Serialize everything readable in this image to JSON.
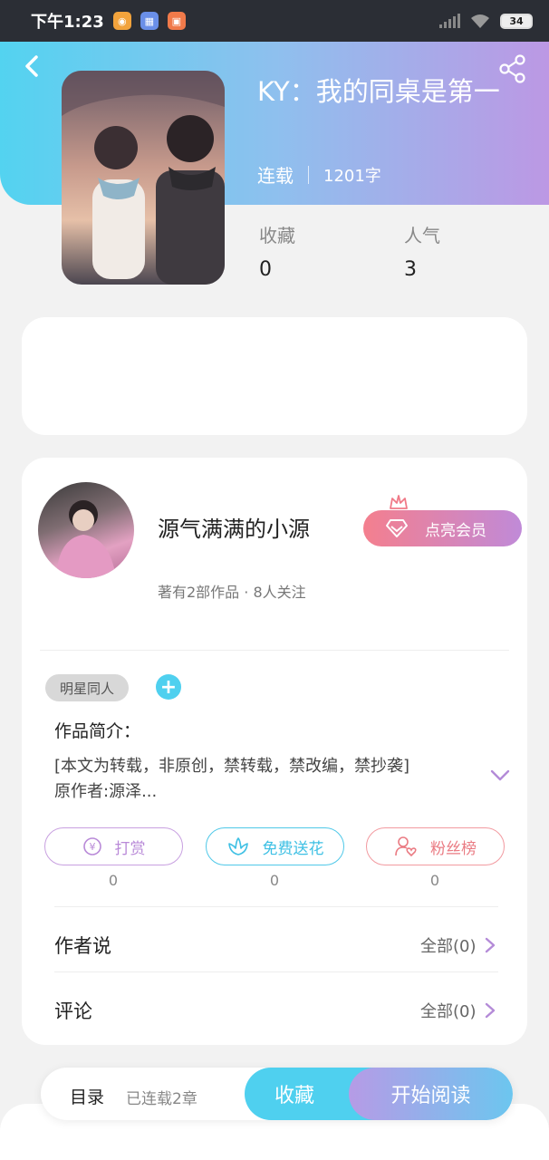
{
  "status_bar": {
    "time": "下午1:23",
    "battery": "34"
  },
  "book": {
    "title": "KY：我的同桌是第一",
    "status": "连载",
    "words": "1201字",
    "stats": [
      {
        "label": "收藏",
        "value": "0"
      },
      {
        "label": "人气",
        "value": "3"
      }
    ]
  },
  "author": {
    "name": "源气满满的小源",
    "sub": "著有2部作品 · 8人关注",
    "vip_label": "点亮会员"
  },
  "tag": "明星同人",
  "intro": {
    "title": "作品简介：",
    "text": "[本文为转载，非原创，禁转载，禁改编，禁抄袭]\n原作者:源泽..."
  },
  "actions": [
    {
      "label": "打赏",
      "count": "0",
      "color": "#b98ad8"
    },
    {
      "label": "免费送花",
      "count": "0",
      "color": "#4fc8e8"
    },
    {
      "label": "粉丝榜",
      "count": "0",
      "color": "#ee7f86"
    }
  ],
  "rows": [
    {
      "label": "作者说",
      "right": "全部(0)"
    },
    {
      "label": "评论",
      "right": "全部(0)"
    }
  ],
  "bottom": {
    "toc_label": "目录",
    "toc_sub": "已连载2章",
    "collect_label": "收藏",
    "read_label": "开始阅读"
  }
}
